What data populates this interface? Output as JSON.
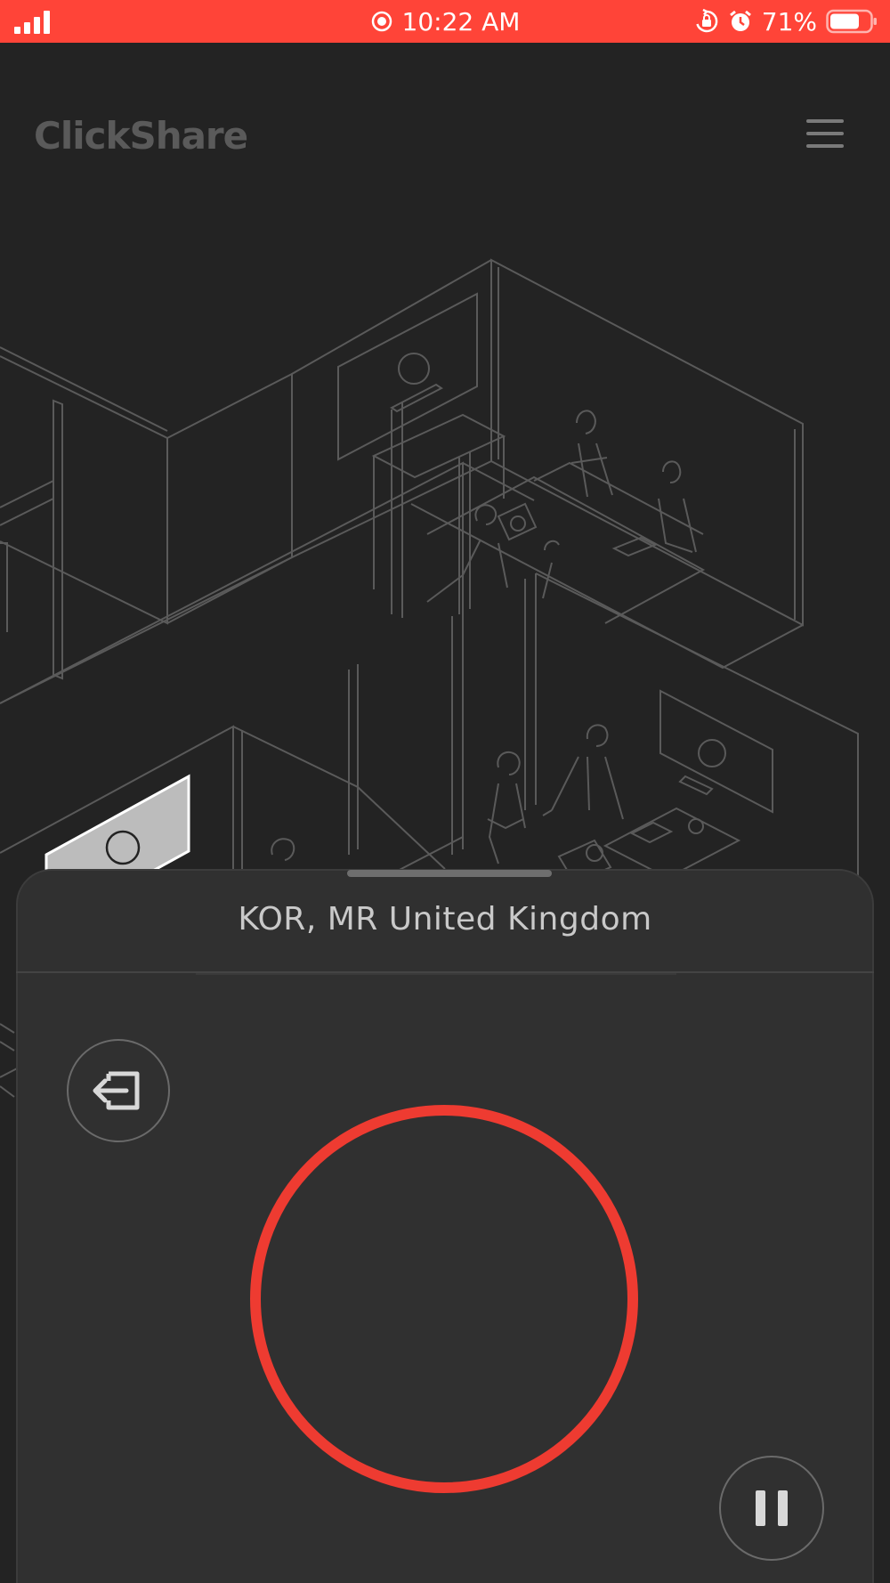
{
  "status_bar": {
    "time": "10:22 AM",
    "battery": "71%",
    "background": "#ff4438",
    "icons": [
      "signal-icon",
      "recording-icon",
      "rotation-lock-icon",
      "alarm-icon",
      "battery-icon"
    ]
  },
  "header": {
    "logo": "ClickShare",
    "menu_icon": "hamburger-menu-icon"
  },
  "illustration": {
    "icon": "office-meeting-rooms-illustration"
  },
  "sheet": {
    "room_name": "KOR, MR United Kingdom",
    "leave_icon": "leave-meeting-icon",
    "pause_icon": "pause-icon",
    "share_button_color": "#ee3b31"
  }
}
